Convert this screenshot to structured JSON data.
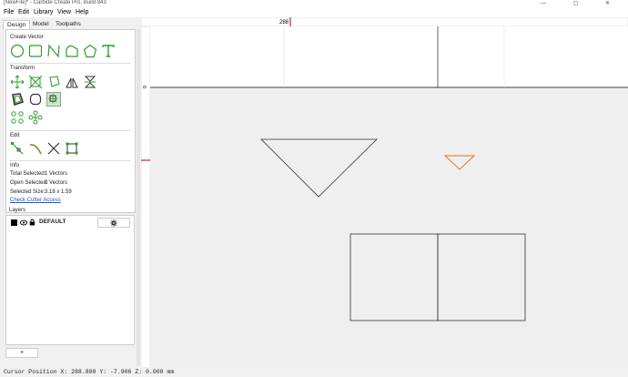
{
  "window": {
    "title": "[NewFile]* - Carbide Create Pro, Build 843",
    "controls": "—  ▢  ✕"
  },
  "menu": {
    "file": "File",
    "edit": "Edit",
    "library": "Library",
    "view": "View",
    "help": "Help"
  },
  "tabs": {
    "design": "Design",
    "model": "Model",
    "toolpaths": "Toolpaths"
  },
  "create_vector": {
    "title": "Create Vector"
  },
  "transform": {
    "title": "Transform"
  },
  "edit": {
    "title": "Edit"
  },
  "info": {
    "title": "Info",
    "total_label": "Total Selected:",
    "total_value": "1 Vectors",
    "open_label": "Open Selected:",
    "open_value": "0 Vectors",
    "size_label": "Selected Size:",
    "size_value": "3.18 x 1.59",
    "cutter_link": "Check Cutter Access"
  },
  "layers": {
    "title": "Layers",
    "items": [
      {
        "name": "DEFAULT"
      }
    ],
    "add_label": "+"
  },
  "ruler": {
    "top_marker": "288",
    "left_marker": "0"
  },
  "status": {
    "cursor": "Cursor Position X: 288.800 Y: -7.906 Z: 0.000 mm"
  },
  "colors": {
    "accent": "#2e9e2e",
    "selected_shape": "#e07b1e",
    "marker": "#d22020"
  },
  "icons": {
    "circle": "circle-icon",
    "rectangle": "rectangle-icon",
    "curve": "curve-icon",
    "polygon": "polygon-icon",
    "pentagon": "pentagon-icon",
    "text": "text-icon",
    "gear": "gear-icon",
    "eye": "eye-icon",
    "lock": "lock-icon"
  }
}
